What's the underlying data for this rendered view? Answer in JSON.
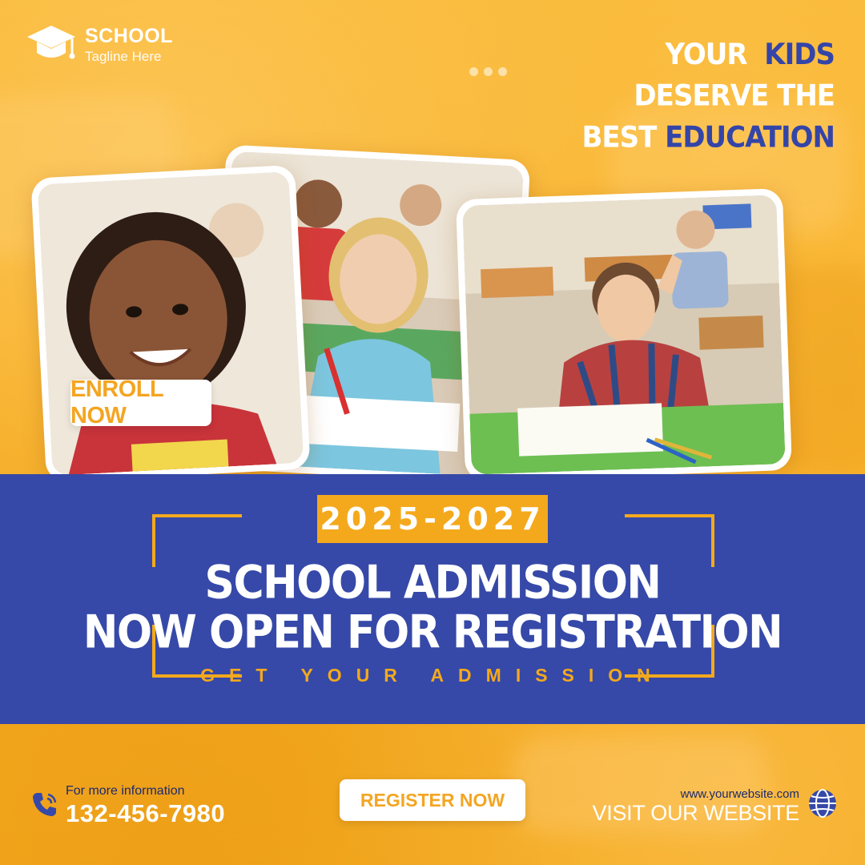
{
  "brand": {
    "name": "SCHOOL",
    "tagline": "Tagline Here",
    "icon": "graduation-cap-icon"
  },
  "headline": {
    "line1": [
      {
        "text": "YOUR",
        "tone": "white"
      },
      {
        "text": "KIDS",
        "tone": "blue"
      }
    ],
    "line2": [
      {
        "text": "DESERVE THE",
        "tone": "white"
      }
    ],
    "line3": [
      {
        "text": "BEST",
        "tone": "white"
      },
      {
        "text": "EDUCATION",
        "tone": "blue"
      }
    ]
  },
  "enroll_label": "ENROLL NOW",
  "banner": {
    "year": "2025-2027",
    "title_line1": "SCHOOL ADMISSION",
    "title_line2": "NOW OPEN FOR REGISTRATION",
    "subtitle": "GET YOUR ADMISSION"
  },
  "contact": {
    "label": "For more information",
    "phone": "132-456-7980",
    "icon": "phone-icon"
  },
  "register_label": "REGISTER NOW",
  "website": {
    "url": "www.yourwebsite.com",
    "cta": "VISIT OUR WEBSITE",
    "icon": "globe-icon"
  },
  "colors": {
    "accent_yellow": "#f4a91c",
    "brand_blue": "#3649a8",
    "background": "#f8b22a"
  }
}
